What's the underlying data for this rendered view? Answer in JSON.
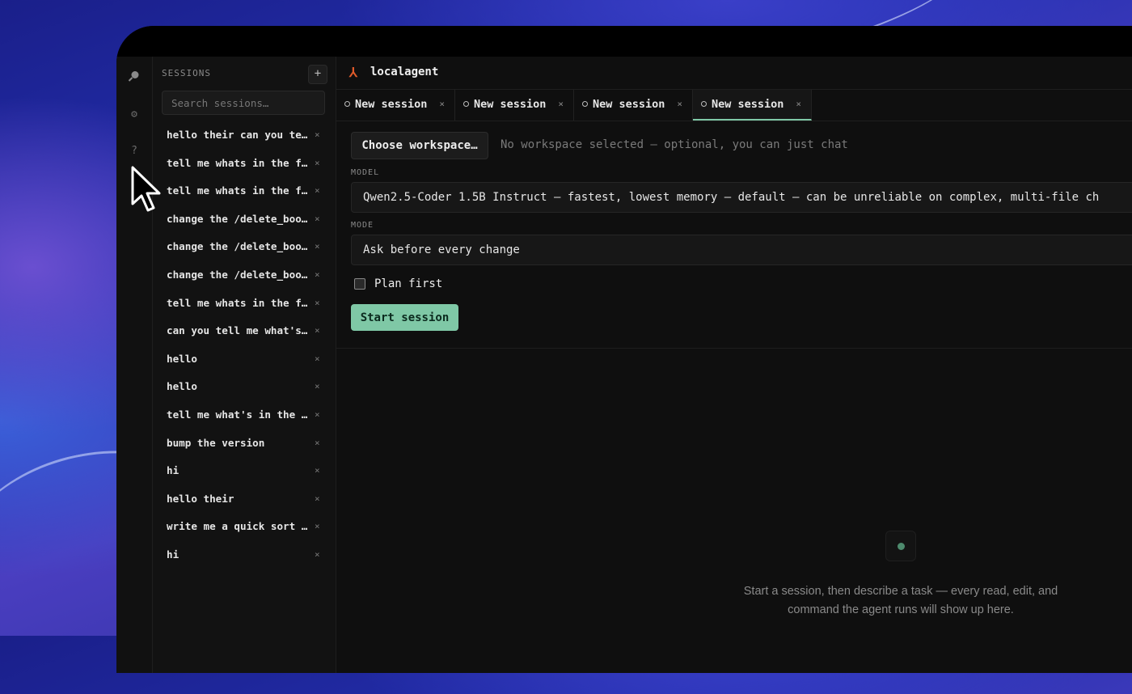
{
  "app": {
    "title": "localagent",
    "logo_glyph": "⅄"
  },
  "rail": {
    "icons": [
      "search-icon",
      "gear-icon",
      "help-icon"
    ]
  },
  "sidebar": {
    "title": "SESSIONS",
    "add_label": "+",
    "search_placeholder": "Search sessions…",
    "close_glyph": "×",
    "sessions": [
      "hello their can you te…",
      "tell me whats in the f…",
      "tell me whats in the f…",
      "change the /delete_boo…",
      "change the /delete_boo…",
      "change the /delete_boo…",
      "tell me whats in the f…",
      "can you tell me what's…",
      "hello",
      "hello",
      "tell me what's in the …",
      "bump the version",
      "hi",
      "hello their",
      "write me a quick sort …",
      "hi"
    ]
  },
  "tabs": [
    {
      "label": "New session",
      "active": false
    },
    {
      "label": "New session",
      "active": false
    },
    {
      "label": "New session",
      "active": false
    },
    {
      "label": "New session",
      "active": true
    }
  ],
  "form": {
    "workspace_button": "Choose workspace…",
    "workspace_note": "No workspace selected — optional, you can just chat",
    "model_label": "MODEL",
    "model_value": "Qwen2.5-Coder 1.5B Instruct — fastest, lowest memory — default — can be unreliable on complex, multi-file ch",
    "mode_label": "MODE",
    "mode_value": "Ask before every change",
    "plan_first_label": "Plan first",
    "start_button": "Start session"
  },
  "empty_state": {
    "message": "Start a session, then describe a task — every read, edit, and command the agent runs will show up here."
  },
  "colors": {
    "accent": "#7fc8a6",
    "logo": "#e05a2a"
  }
}
